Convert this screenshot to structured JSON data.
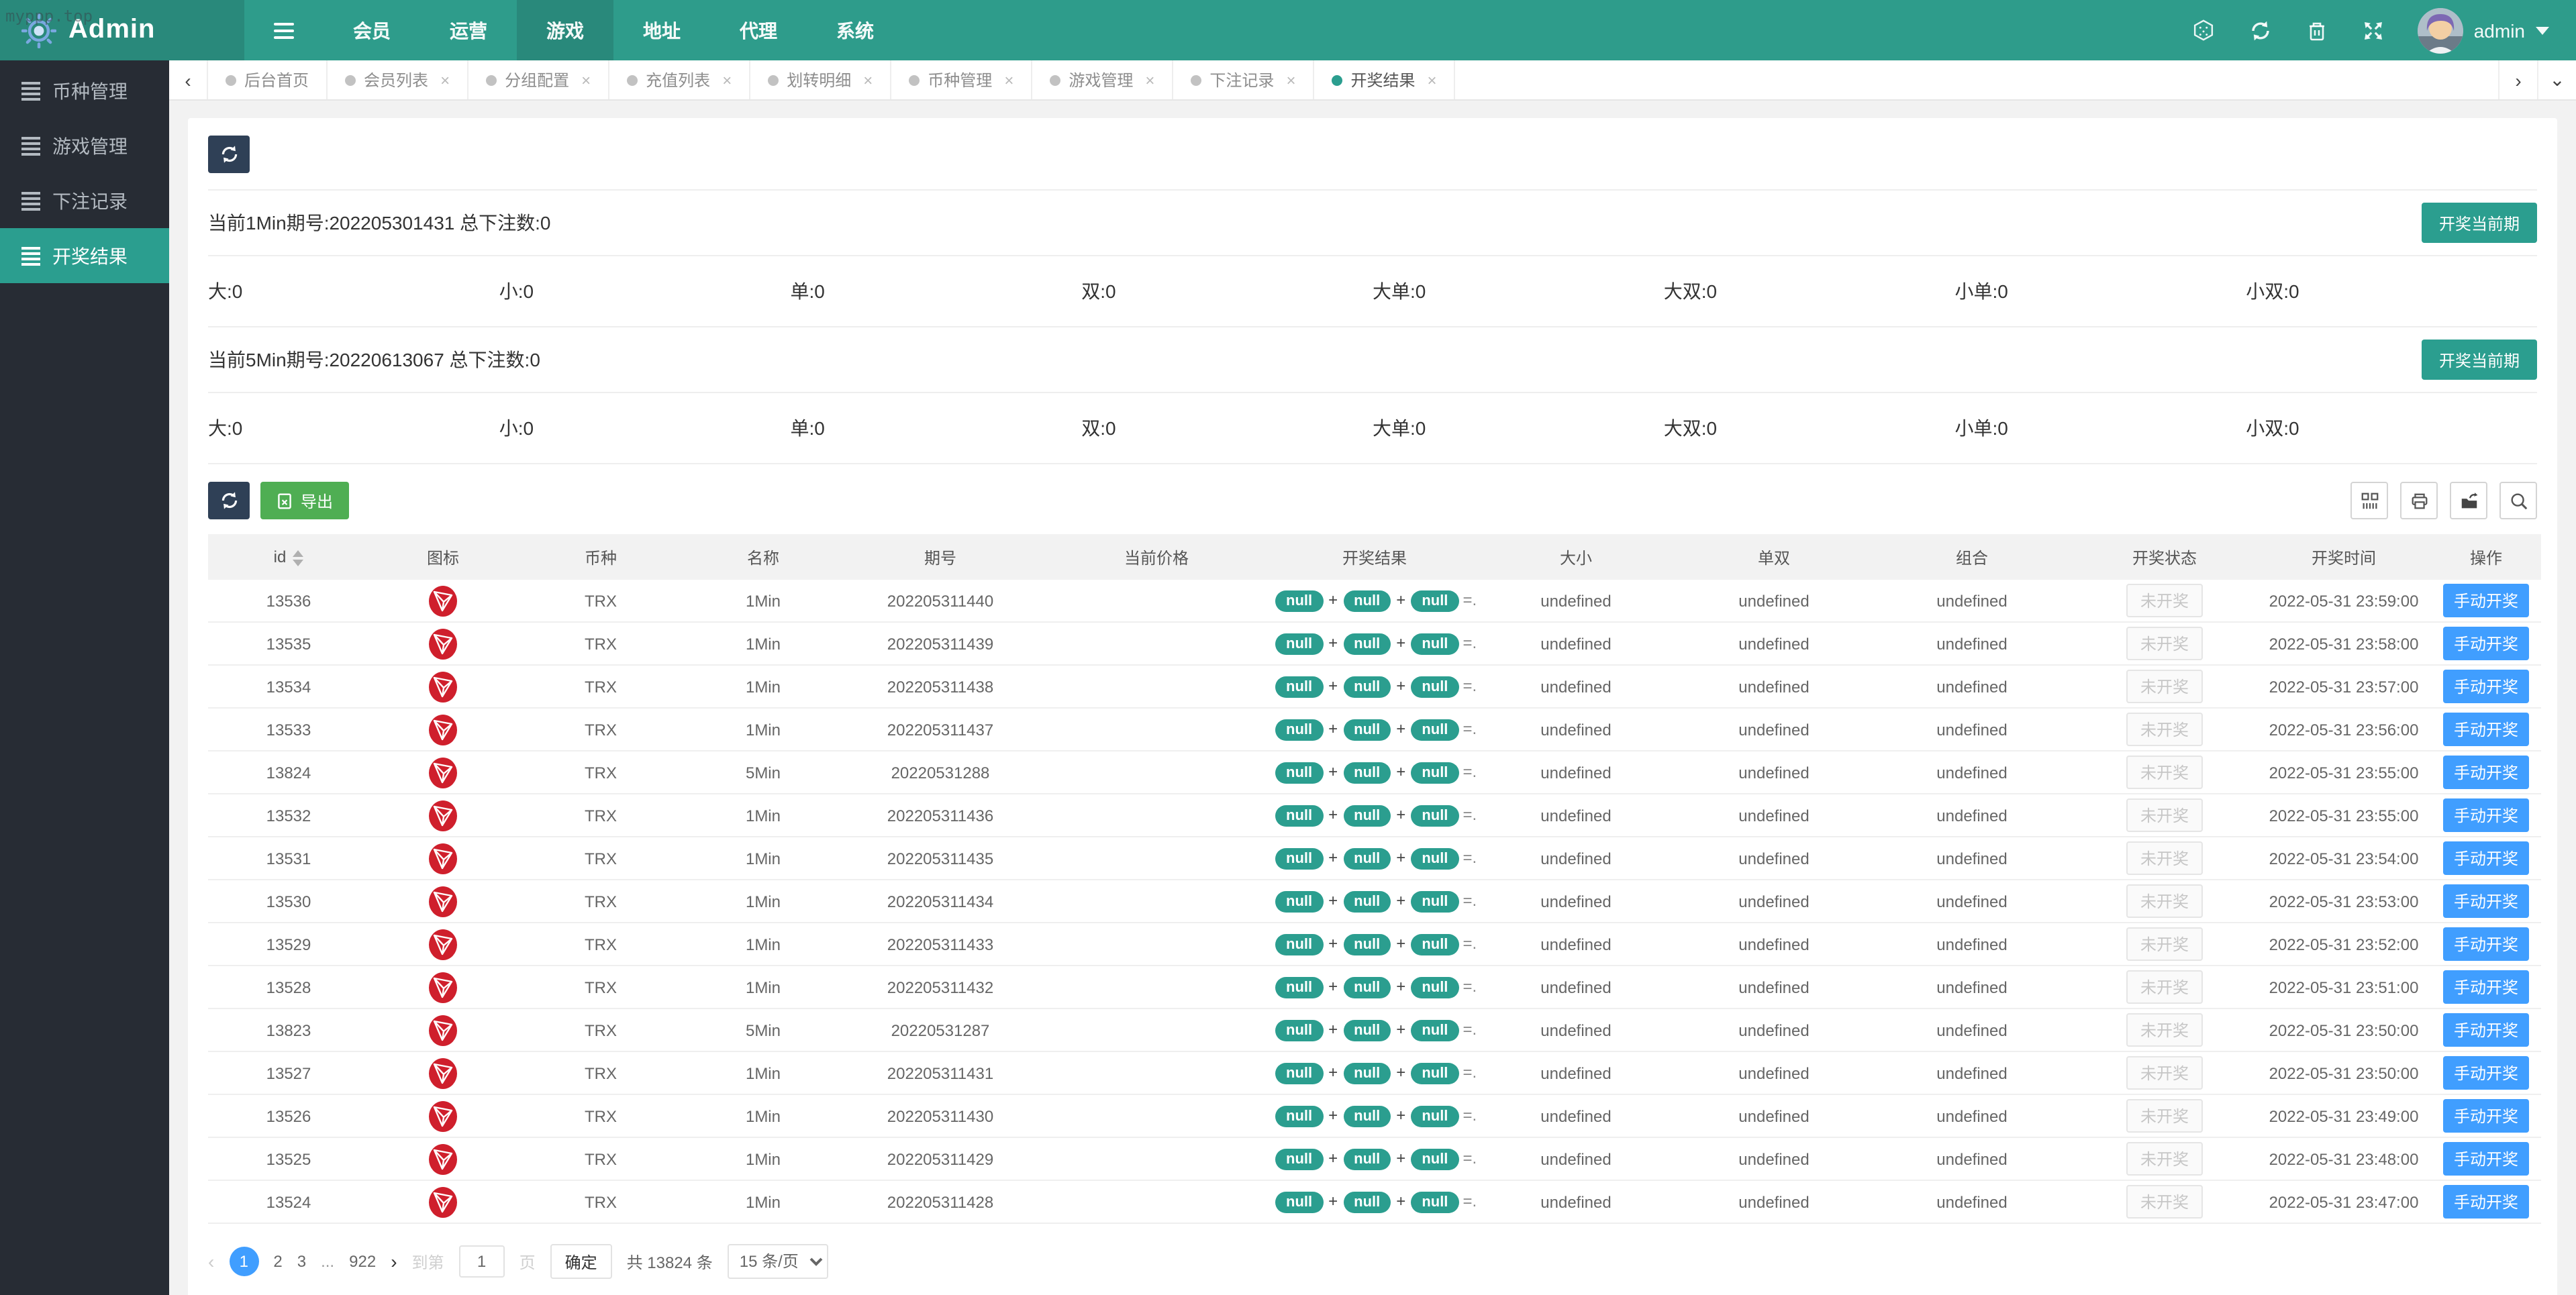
{
  "watermark": "myppp.top",
  "navbar": {
    "brand": "Admin",
    "menu": [
      "会员",
      "运营",
      "游戏",
      "地址",
      "代理",
      "系统"
    ],
    "active_menu": "游戏",
    "username": "admin"
  },
  "tabs": [
    {
      "label": "后台首页",
      "active": false,
      "closable": false
    },
    {
      "label": "会员列表",
      "active": false,
      "closable": true
    },
    {
      "label": "分组配置",
      "active": false,
      "closable": true
    },
    {
      "label": "充值列表",
      "active": false,
      "closable": true
    },
    {
      "label": "划转明细",
      "active": false,
      "closable": true
    },
    {
      "label": "币种管理",
      "active": false,
      "closable": true
    },
    {
      "label": "游戏管理",
      "active": false,
      "closable": true
    },
    {
      "label": "下注记录",
      "active": false,
      "closable": true
    },
    {
      "label": "开奖结果",
      "active": true,
      "closable": true
    }
  ],
  "sidebar": [
    {
      "label": "币种管理",
      "active": false
    },
    {
      "label": "游戏管理",
      "active": false
    },
    {
      "label": "下注记录",
      "active": false
    },
    {
      "label": "开奖结果",
      "active": true
    }
  ],
  "panels": [
    {
      "title": "当前1Min期号:202205301431 总下注数:0",
      "button": "开奖当前期",
      "stats": [
        "大:0",
        "小:0",
        "单:0",
        "双:0",
        "大单:0",
        "大双:0",
        "小单:0",
        "小双:0"
      ]
    },
    {
      "title": "当前5Min期号:20220613067 总下注数:0",
      "button": "开奖当前期",
      "stats": [
        "大:0",
        "小:0",
        "单:0",
        "双:0",
        "大单:0",
        "大双:0",
        "小单:0",
        "小双:0"
      ]
    }
  ],
  "toolbar": {
    "export_label": "导出"
  },
  "table": {
    "headers": [
      "id",
      "图标",
      "币种",
      "名称",
      "期号",
      "当前价格",
      "开奖结果",
      "大小",
      "单双",
      "组合",
      "开奖状态",
      "开奖时间",
      "操作"
    ],
    "result_badges": [
      "null",
      "null",
      "null"
    ],
    "result_suffix": "=...",
    "rows": [
      {
        "id": "13536",
        "coin": "TRX",
        "name": "1Min",
        "issue": "202205311440",
        "price": "",
        "size": "undefined",
        "parity": "undefined",
        "combo": "undefined",
        "status": "未开奖",
        "time": "2022-05-31 23:59:00",
        "action": "手动开奖"
      },
      {
        "id": "13535",
        "coin": "TRX",
        "name": "1Min",
        "issue": "202205311439",
        "price": "",
        "size": "undefined",
        "parity": "undefined",
        "combo": "undefined",
        "status": "未开奖",
        "time": "2022-05-31 23:58:00",
        "action": "手动开奖"
      },
      {
        "id": "13534",
        "coin": "TRX",
        "name": "1Min",
        "issue": "202205311438",
        "price": "",
        "size": "undefined",
        "parity": "undefined",
        "combo": "undefined",
        "status": "未开奖",
        "time": "2022-05-31 23:57:00",
        "action": "手动开奖"
      },
      {
        "id": "13533",
        "coin": "TRX",
        "name": "1Min",
        "issue": "202205311437",
        "price": "",
        "size": "undefined",
        "parity": "undefined",
        "combo": "undefined",
        "status": "未开奖",
        "time": "2022-05-31 23:56:00",
        "action": "手动开奖"
      },
      {
        "id": "13824",
        "coin": "TRX",
        "name": "5Min",
        "issue": "20220531288",
        "price": "",
        "size": "undefined",
        "parity": "undefined",
        "combo": "undefined",
        "status": "未开奖",
        "time": "2022-05-31 23:55:00",
        "action": "手动开奖"
      },
      {
        "id": "13532",
        "coin": "TRX",
        "name": "1Min",
        "issue": "202205311436",
        "price": "",
        "size": "undefined",
        "parity": "undefined",
        "combo": "undefined",
        "status": "未开奖",
        "time": "2022-05-31 23:55:00",
        "action": "手动开奖"
      },
      {
        "id": "13531",
        "coin": "TRX",
        "name": "1Min",
        "issue": "202205311435",
        "price": "",
        "size": "undefined",
        "parity": "undefined",
        "combo": "undefined",
        "status": "未开奖",
        "time": "2022-05-31 23:54:00",
        "action": "手动开奖"
      },
      {
        "id": "13530",
        "coin": "TRX",
        "name": "1Min",
        "issue": "202205311434",
        "price": "",
        "size": "undefined",
        "parity": "undefined",
        "combo": "undefined",
        "status": "未开奖",
        "time": "2022-05-31 23:53:00",
        "action": "手动开奖"
      },
      {
        "id": "13529",
        "coin": "TRX",
        "name": "1Min",
        "issue": "202205311433",
        "price": "",
        "size": "undefined",
        "parity": "undefined",
        "combo": "undefined",
        "status": "未开奖",
        "time": "2022-05-31 23:52:00",
        "action": "手动开奖"
      },
      {
        "id": "13528",
        "coin": "TRX",
        "name": "1Min",
        "issue": "202205311432",
        "price": "",
        "size": "undefined",
        "parity": "undefined",
        "combo": "undefined",
        "status": "未开奖",
        "time": "2022-05-31 23:51:00",
        "action": "手动开奖"
      },
      {
        "id": "13823",
        "coin": "TRX",
        "name": "5Min",
        "issue": "20220531287",
        "price": "",
        "size": "undefined",
        "parity": "undefined",
        "combo": "undefined",
        "status": "未开奖",
        "time": "2022-05-31 23:50:00",
        "action": "手动开奖"
      },
      {
        "id": "13527",
        "coin": "TRX",
        "name": "1Min",
        "issue": "202205311431",
        "price": "",
        "size": "undefined",
        "parity": "undefined",
        "combo": "undefined",
        "status": "未开奖",
        "time": "2022-05-31 23:50:00",
        "action": "手动开奖"
      },
      {
        "id": "13526",
        "coin": "TRX",
        "name": "1Min",
        "issue": "202205311430",
        "price": "",
        "size": "undefined",
        "parity": "undefined",
        "combo": "undefined",
        "status": "未开奖",
        "time": "2022-05-31 23:49:00",
        "action": "手动开奖"
      },
      {
        "id": "13525",
        "coin": "TRX",
        "name": "1Min",
        "issue": "202205311429",
        "price": "",
        "size": "undefined",
        "parity": "undefined",
        "combo": "undefined",
        "status": "未开奖",
        "time": "2022-05-31 23:48:00",
        "action": "手动开奖"
      },
      {
        "id": "13524",
        "coin": "TRX",
        "name": "1Min",
        "issue": "202205311428",
        "price": "",
        "size": "undefined",
        "parity": "undefined",
        "combo": "undefined",
        "status": "未开奖",
        "time": "2022-05-31 23:47:00",
        "action": "手动开奖"
      }
    ]
  },
  "pagination": {
    "prev": "‹",
    "next": "›",
    "pages": [
      "1",
      "2",
      "3",
      "...",
      "922"
    ],
    "active_page": "1",
    "goto_label": "到第",
    "goto_value": "1",
    "goto_suffix": "页",
    "confirm_label": "确定",
    "total_label": "共 13824 条",
    "page_size_label": "15 条/页"
  },
  "colors": {
    "navbar_teal": "#2e9c8b",
    "navbar_dark_teal": "#29897b",
    "sidebar_dark": "#272c34",
    "accent_teal": "#2b9e8f",
    "dark_button": "#2f4056",
    "export_green": "#4fae53",
    "action_blue": "#409eff",
    "trx_red": "#cf1f2c"
  }
}
